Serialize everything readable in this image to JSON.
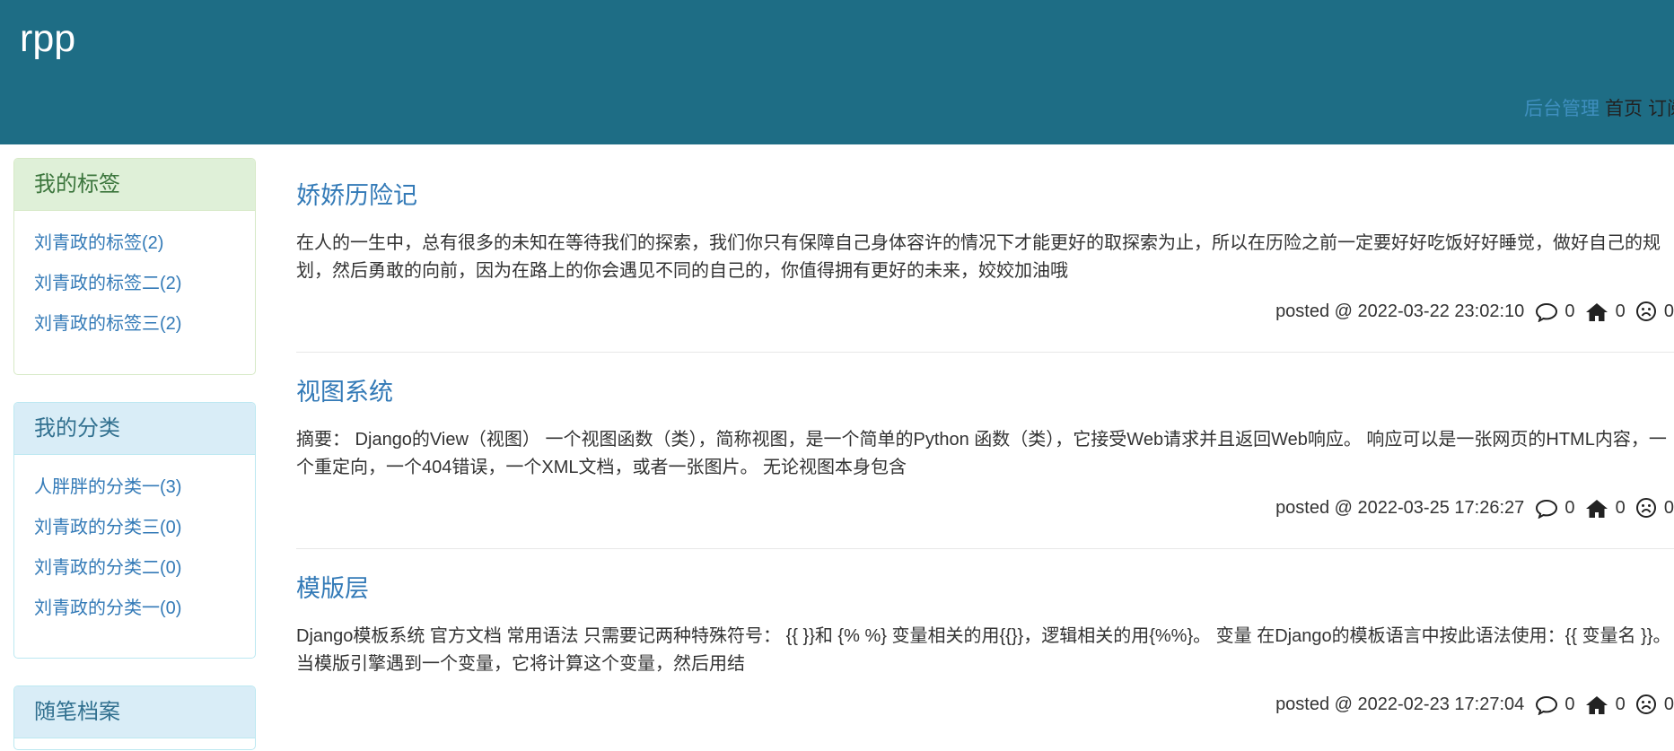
{
  "header": {
    "site_title": "rpp",
    "nav": {
      "admin_label": "后台管理",
      "home_label": "首页",
      "subscribe_label": "订阅"
    }
  },
  "sidebar": {
    "tags": {
      "title": "我的标签",
      "items": [
        {
          "label": "刘青政的标签(2)"
        },
        {
          "label": "刘青政的标签二(2)"
        },
        {
          "label": "刘青政的标签三(2)"
        }
      ]
    },
    "categories": {
      "title": "我的分类",
      "items": [
        {
          "label": "人胖胖的分类一(3)"
        },
        {
          "label": "刘青政的分类三(0)"
        },
        {
          "label": "刘青政的分类二(0)"
        },
        {
          "label": "刘青政的分类一(0)"
        }
      ]
    },
    "archive": {
      "title": "随笔档案"
    }
  },
  "posts": [
    {
      "title": "娇娇历险记",
      "summary": "在人的一生中，总有很多的未知在等待我们的探索，我们你只有保障自己身体容许的情况下才能更好的取探索为止，所以在历险之前一定要好好吃饭好好睡觉，做好自己的规划，然后勇敢的向前，因为在路上的你会遇见不同的自己的，你值得拥有更好的未来，姣姣加油哦",
      "posted": "posted @ 2022-03-22 23:02:10",
      "comments": "0",
      "likes": "0",
      "dislikes": "0"
    },
    {
      "title": "视图系统",
      "summary": "摘要： Django的View（视图） 一个视图函数（类），简称视图，是一个简单的Python 函数（类），它接受Web请求并且返回Web响应。 响应可以是一张网页的HTML内容，一个重定向，一个404错误，一个XML文档，或者一张图片。 无论视图本身包含",
      "posted": "posted @ 2022-03-25 17:26:27",
      "comments": "0",
      "likes": "0",
      "dislikes": "0"
    },
    {
      "title": "模版层",
      "summary": "Django模板系统 官方文档 常用语法 只需要记两种特殊符号： {{ }}和 {% %} 变量相关的用{{}}，逻辑相关的用{%%}。 变量 在Django的模板语言中按此语法使用：{{ 变量名 }}。 当模版引擎遇到一个变量，它将计算这个变量，然后用结",
      "posted": "posted @ 2022-02-23 17:27:04",
      "comments": "0",
      "likes": "0",
      "dislikes": "0"
    }
  ]
}
